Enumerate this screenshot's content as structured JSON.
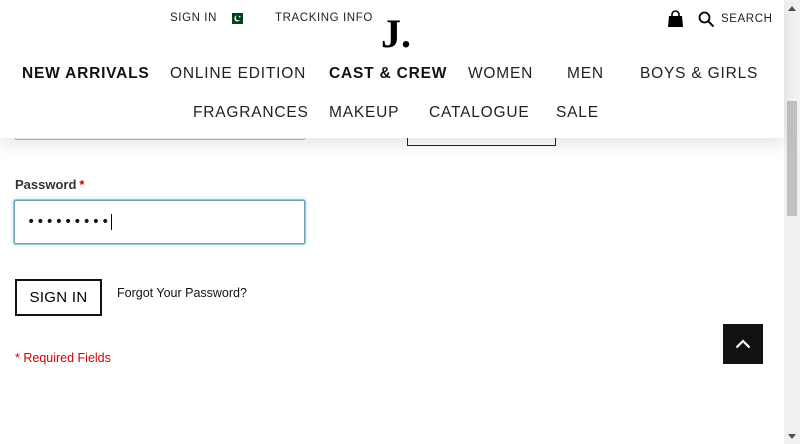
{
  "header": {
    "util_links": {
      "sign_in": "SIGN IN",
      "tracking": "TRACKING INFO",
      "search": "SEARCH"
    },
    "logo": "J.",
    "nav_row1": [
      "NEW ARRIVALS",
      "ONLINE EDITION",
      "CAST & CREW",
      "WOMEN",
      "MEN",
      "BOYS & GIRLS"
    ],
    "nav_row2": [
      "FRAGRANCES",
      "MAKEUP",
      "CATALOGUE",
      "SALE"
    ],
    "icons": {
      "flag": "pakistan-flag-icon",
      "bag": "shopping-bag-icon",
      "search": "search-icon"
    }
  },
  "form": {
    "password_label": "Password",
    "required_marker": "*",
    "password_value": "•••••••••",
    "sign_in_button": "SIGN IN",
    "forgot_link": "Forgot Your Password?",
    "required_note": "* Required Fields"
  },
  "colors": {
    "required": "#d40000",
    "focus_border": "#6f9fb3",
    "flag_green": "#01411c",
    "back_to_top_bg": "#111111"
  }
}
